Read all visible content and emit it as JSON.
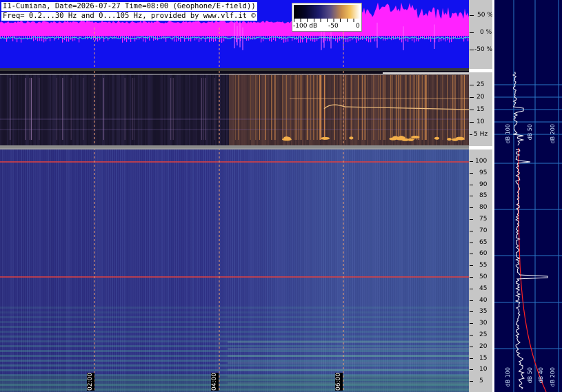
{
  "header": {
    "line1": "I1-Cumiana, Date=2026-07-27 Time=08:00 (Geophone/E-field))",
    "line2": "Freq= 0.2...30 Hz and 0...105 Hz, provided by www.vlf.it ©"
  },
  "colorbar": {
    "labels": [
      "-100 dB",
      "-50",
      "0"
    ]
  },
  "waveform": {
    "percent_labels": [
      "50 %",
      "0 %",
      "-50 %"
    ],
    "colors": {
      "background": "#1111ee",
      "envelope": "#ff22ff",
      "trace": "#33dddd"
    }
  },
  "low_spectrogram": {
    "freq_labels": [
      "25",
      "20",
      "15",
      "10",
      "5 Hz"
    ]
  },
  "main_spectrogram": {
    "freq_labels": [
      "100",
      "95",
      "90",
      "85",
      "80",
      "75",
      "70",
      "65",
      "60",
      "55",
      "50",
      "45",
      "40",
      "35",
      "30",
      "25",
      "20",
      "15",
      "10",
      "5"
    ]
  },
  "time_axis": {
    "labels": [
      "02:00",
      "04:00",
      "06:00"
    ]
  },
  "spectrum_panels": {
    "upper_labels": [
      "dB 100",
      "dB 50",
      "dB 200"
    ],
    "lower_labels": [
      "dB 100",
      "dB 50",
      "dB 40",
      "dB 200"
    ],
    "colors": {
      "background": "#00004a",
      "trace": "#ffffff",
      "fit": "#ff2222",
      "grid": "#2a78c8"
    }
  }
}
